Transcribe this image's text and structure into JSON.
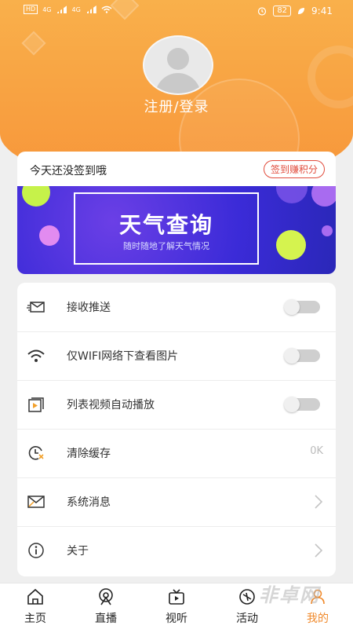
{
  "status_bar": {
    "network_tags": [
      "HD",
      "HD"
    ],
    "network_types": [
      "4G",
      "4G"
    ],
    "battery": "82",
    "time": "9:41"
  },
  "profile": {
    "login_label": "注册/登录"
  },
  "signin": {
    "prompt": "今天还没签到哦",
    "button": "签到赚积分"
  },
  "banner": {
    "title": "天气查询",
    "subtitle": "随时随地了解天气情况"
  },
  "settings": [
    {
      "label": "接收推送",
      "type": "toggle",
      "on": false,
      "icon": "mail-send-icon"
    },
    {
      "label": "仅WIFI网络下查看图片",
      "type": "toggle",
      "on": false,
      "icon": "wifi-icon"
    },
    {
      "label": "列表视频自动播放",
      "type": "toggle",
      "on": false,
      "icon": "video-play-icon"
    },
    {
      "label": "清除缓存",
      "type": "value",
      "value": "0K",
      "icon": "clear-cache-icon"
    },
    {
      "label": "系统消息",
      "type": "link",
      "icon": "envelope-icon"
    },
    {
      "label": "关于",
      "type": "link",
      "icon": "info-icon"
    }
  ],
  "tabs": [
    {
      "label": "主页",
      "icon": "home-icon",
      "active": false
    },
    {
      "label": "直播",
      "icon": "live-icon",
      "active": false
    },
    {
      "label": "视听",
      "icon": "tv-icon",
      "active": false
    },
    {
      "label": "活动",
      "icon": "activity-icon",
      "active": false
    },
    {
      "label": "我的",
      "icon": "profile-icon",
      "active": true
    }
  ],
  "colors": {
    "header_orange": "#f7963a",
    "accent_red": "#e14c3c",
    "active_tab": "#f08a2c",
    "banner_blue": "#3b2bd8"
  },
  "watermark": "非卓网"
}
